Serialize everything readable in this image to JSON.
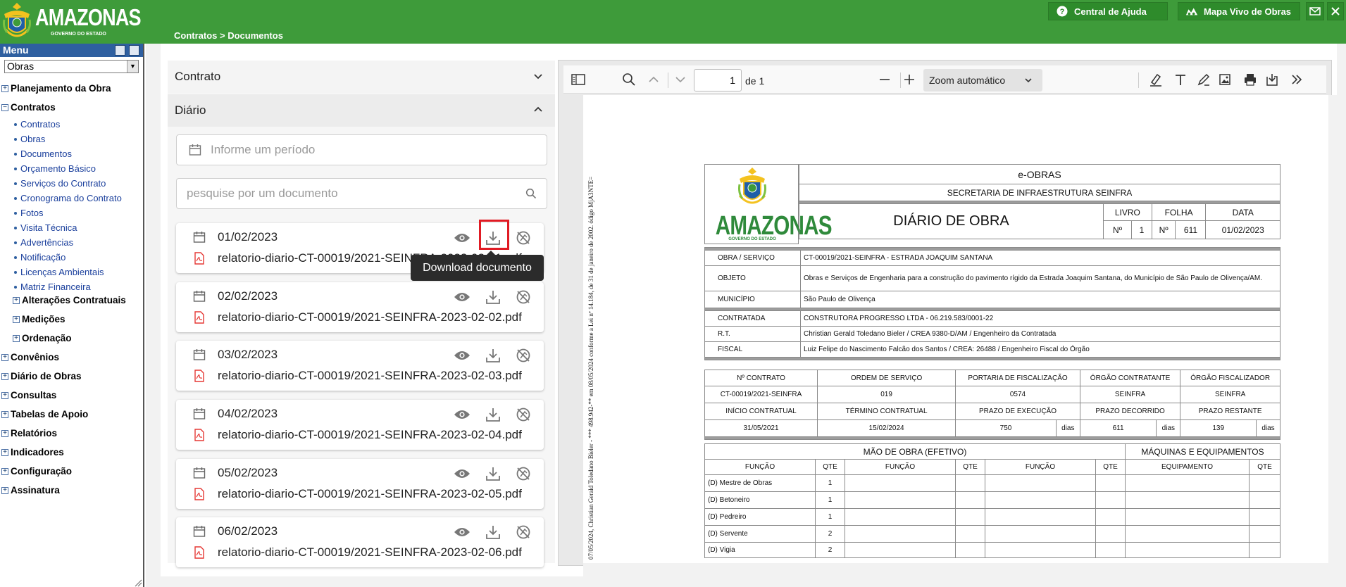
{
  "header": {
    "logo_text": "AMAZONAS",
    "logo_sub": "GOVERNO DO ESTADO",
    "breadcrumb": "Contratos > Documentos",
    "help_label": "Central de Ajuda",
    "map_label": "Mapa Vivo de Obras"
  },
  "sidebar": {
    "menu_title": "Menu",
    "select_value": "Obras",
    "groups": {
      "planejamento": "Planejamento da Obra",
      "contratos": "Contratos",
      "alteracoes": "Alterações Contratuais",
      "medicoes": "Medições",
      "ordenacao": "Ordenação",
      "convenios": "Convênios",
      "diario": "Diário de Obras",
      "consultas": "Consultas",
      "tabelas": "Tabelas de Apoio",
      "relatorios": "Relatórios",
      "indicadores": "Indicadores",
      "configuracao": "Configuração",
      "assinatura": "Assinatura"
    },
    "leaves": [
      "Contratos",
      "Obras",
      "Documentos",
      "Orçamento Básico",
      "Serviços do Contrato",
      "Cronograma do Contrato",
      "Fotos",
      "Visita Técnica",
      "Advertências",
      "Notificação",
      "Licenças Ambientais",
      "Matriz Financeira"
    ]
  },
  "panel": {
    "contrato_label": "Contrato",
    "diario_label": "Diário",
    "period_placeholder": "Informe um período",
    "search_placeholder": "pesquise por um documento",
    "tooltip": "Download documento",
    "docs": [
      {
        "date": "01/02/2023",
        "file": "relatorio-diario-CT-00019/2021-SEINFRA-2023-02-01.pdf"
      },
      {
        "date": "02/02/2023",
        "file": "relatorio-diario-CT-00019/2021-SEINFRA-2023-02-02.pdf"
      },
      {
        "date": "03/02/2023",
        "file": "relatorio-diario-CT-00019/2021-SEINFRA-2023-02-03.pdf"
      },
      {
        "date": "04/02/2023",
        "file": "relatorio-diario-CT-00019/2021-SEINFRA-2023-02-04.pdf"
      },
      {
        "date": "05/02/2023",
        "file": "relatorio-diario-CT-00019/2021-SEINFRA-2023-02-05.pdf"
      },
      {
        "date": "06/02/2023",
        "file": "relatorio-diario-CT-00019/2021-SEINFRA-2023-02-06.pdf"
      }
    ]
  },
  "viewer": {
    "page": "1",
    "of_label": "de 1",
    "zoom": "Zoom automático"
  },
  "pdf": {
    "side_text": "07/05/2024, Christian Gerald Toledano Bieler - *** 498.942-** em 08/05/2024 conforme a Lei nº 14.184, de 31 de janeiro de 2002. ódigo MjA3NTE=",
    "emblem_word": "AMAZONAS",
    "emblem_sub": "GOVERNO DO ESTADO",
    "system": "e-OBRAS",
    "secretaria": "SECRETARIA DE INFRAESTRUTURA  SEINFRA",
    "title": "DIÁRIO DE OBRA",
    "livro_h": "LIVRO",
    "folha_h": "FOLHA",
    "data_h": "DATA",
    "n1": "Nº",
    "livro": "1",
    "n2": "Nº",
    "folha": "611",
    "data": "01/02/2023",
    "obra_h": "OBRA / SERVIÇO",
    "obra": "CT-00019/2021-SEINFRA - ESTRADA JOAQUIM SANTANA",
    "objeto_h": "OBJETO",
    "objeto": "Obras e Serviços de Engenharia para a construção do pavimento rígido da Estrada Joaquim Santana, do Município de São Paulo de Olivença/AM.",
    "municipio_h": "MUNICÍPIO",
    "municipio": "São Paulo de Olivença",
    "contratada_h": "CONTRATADA",
    "contratada": "CONSTRUTORA PROGRESSO LTDA - 06.219.583/0001-22",
    "rt_h": "R.T.",
    "rt": "Christian Gerald Toledano Bieler / CREA 9380-D/AM / Engenheiro da Contratada",
    "fiscal_h": "FISCAL",
    "fiscal": "Luiz Felipe do Nascimento Falcão dos Santos / CREA: 26488 / Engenheiro Fiscal do Órgão",
    "h_contrato": "Nº CONTRATO",
    "h_ordem": "ORDEM DE SERVIÇO",
    "h_portaria": "PORTARIA DE FISCALIZAÇÃO",
    "h_orgao_c": "ÓRGÃO CONTRATANTE",
    "h_orgao_f": "ÓRGÃO FISCALIZADOR",
    "v_contrato": "CT-00019/2021-SEINFRA",
    "v_ordem": "019",
    "v_portaria": "0574",
    "v_orgao_c": "SEINFRA",
    "v_orgao_f": "SEINFRA",
    "h_inicio": "INÍCIO CONTRATUAL",
    "h_termino": "TÉRMINO CONTRATUAL",
    "h_prazo_exec": "PRAZO DE EXECUÇÃO",
    "h_prazo_dec": "PRAZO DECORRIDO",
    "h_prazo_rest": "PRAZO RESTANTE",
    "v_inicio": "31/05/2021",
    "v_termino": "15/02/2024",
    "v_prazo_exec": "750",
    "v_prazo_dec": "611",
    "v_prazo_rest": "139",
    "dias": "dias",
    "mao_obra": "MÃO DE OBRA (EFETIVO)",
    "maquinas": "MÁQUINAS E EQUIPAMENTOS",
    "funcao": "FUNÇÃO",
    "qte": "QTE",
    "equipamento": "EQUIPAMENTO",
    "workers": [
      {
        "f": "(D) Mestre de Obras",
        "q": "1"
      },
      {
        "f": "(D) Betoneiro",
        "q": "1"
      },
      {
        "f": "(D) Pedreiro",
        "q": "1"
      },
      {
        "f": "(D) Servente",
        "q": "2"
      },
      {
        "f": "(D) Vigia",
        "q": "2"
      }
    ]
  }
}
